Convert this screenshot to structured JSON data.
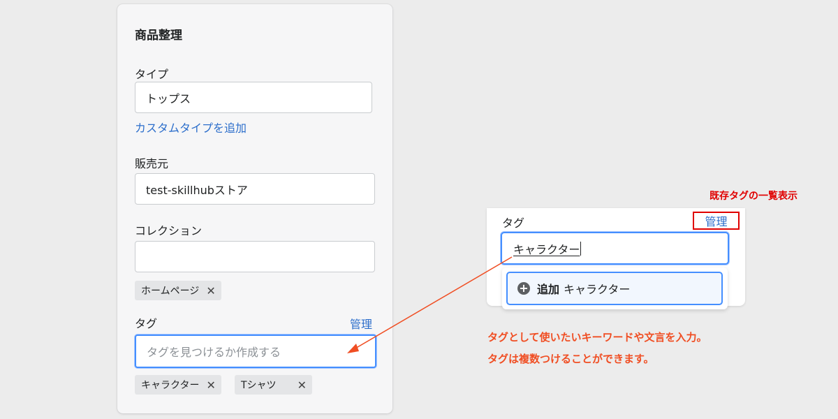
{
  "organization": {
    "title": "商品整理",
    "type": {
      "label": "タイプ",
      "value": "トップス",
      "add_custom_link": "カスタムタイプを追加"
    },
    "vendor": {
      "label": "販売元",
      "value": "test-skillhubストア"
    },
    "collections": {
      "label": "コレクション",
      "value": "",
      "chips": [
        {
          "label": "ホームページ",
          "remove": "✕"
        }
      ]
    },
    "tags": {
      "label": "タグ",
      "manage_link": "管理",
      "placeholder": "タグを見つけるか作成する",
      "chips": [
        {
          "label": "キャラクター",
          "remove": "✕"
        },
        {
          "label": "Tシャツ",
          "remove": "✕"
        }
      ]
    }
  },
  "callout": {
    "tag_label": "タグ",
    "manage_link": "管理",
    "typed_value": "キャラクター",
    "add_option": {
      "icon": "plus-circle-icon",
      "action": "追加",
      "value": "キャラクター"
    }
  },
  "annotations": {
    "manage_note": "既存タグの一覧表示",
    "input_note_line1": "タグとして使いたいキーワードや文言を入力。",
    "input_note_line2": "タグは複数つけることができます。",
    "colors": {
      "red": "#e00000",
      "orange": "#f04e23",
      "link": "#2c6ecb",
      "focus": "#458fff"
    }
  }
}
